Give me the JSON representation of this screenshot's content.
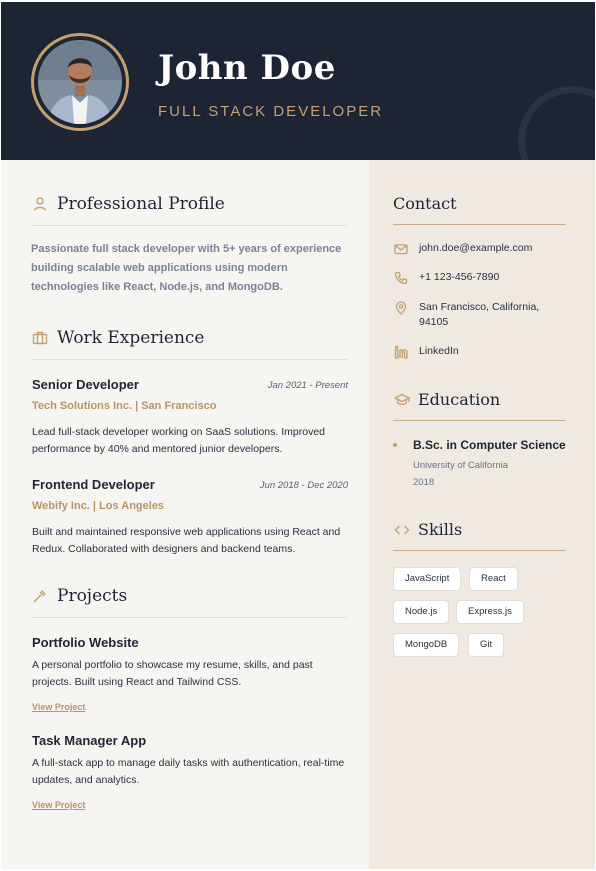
{
  "header": {
    "name": "John Doe",
    "title": "FULL STACK DEVELOPER"
  },
  "profile": {
    "heading": "Professional Profile",
    "text": "Passionate full stack developer with 5+ years of experience building scalable web applications using modern technologies like React, Node.js, and MongoDB."
  },
  "experience": {
    "heading": "Work Experience",
    "jobs": [
      {
        "title": "Senior Developer",
        "date": "Jan 2021 - Present",
        "company": "Tech Solutions Inc. | San Francisco",
        "description": "Lead full-stack developer working on SaaS solutions. Improved performance by 40% and mentored junior developers."
      },
      {
        "title": "Frontend Developer",
        "date": "Jun 2018 - Dec 2020",
        "company": "Webify Inc. | Los Angeles",
        "description": "Built and maintained responsive web applications using React and Redux. Collaborated with designers and backend teams."
      }
    ]
  },
  "projects": {
    "heading": "Projects",
    "items": [
      {
        "title": "Portfolio Website",
        "description": "A personal portfolio to showcase my resume, skills, and past projects. Built using React and Tailwind CSS.",
        "link": "View Project"
      },
      {
        "title": "Task Manager App",
        "description": "A full-stack app to manage daily tasks with authentication, real-time updates, and analytics.",
        "link": "View Project"
      }
    ]
  },
  "contact": {
    "heading": "Contact",
    "email": "john.doe@example.com",
    "phone": "+1 123-456-7890",
    "location": "San Francisco, California, 94105",
    "linkedin": "LinkedIn"
  },
  "education": {
    "heading": "Education",
    "degree": "B.Sc. in Computer Science",
    "school": "University of California",
    "year": "2018"
  },
  "skills": {
    "heading": "Skills",
    "items": [
      "JavaScript",
      "React",
      "Node.js",
      "Express.js",
      "MongoDB",
      "Git"
    ]
  },
  "colors": {
    "header_bg": "#1d2433",
    "accent": "#c4a071",
    "main_bg": "#f7f5f1",
    "sidebar_bg": "#efe9e2"
  },
  "icons": {
    "profile": "user-icon",
    "experience": "briefcase-icon",
    "projects": "tools-icon",
    "email": "mail-icon",
    "phone": "phone-icon",
    "location": "map-pin-icon",
    "linkedin": "linkedin-icon",
    "education": "graduation-cap-icon",
    "skills": "code-icon"
  }
}
